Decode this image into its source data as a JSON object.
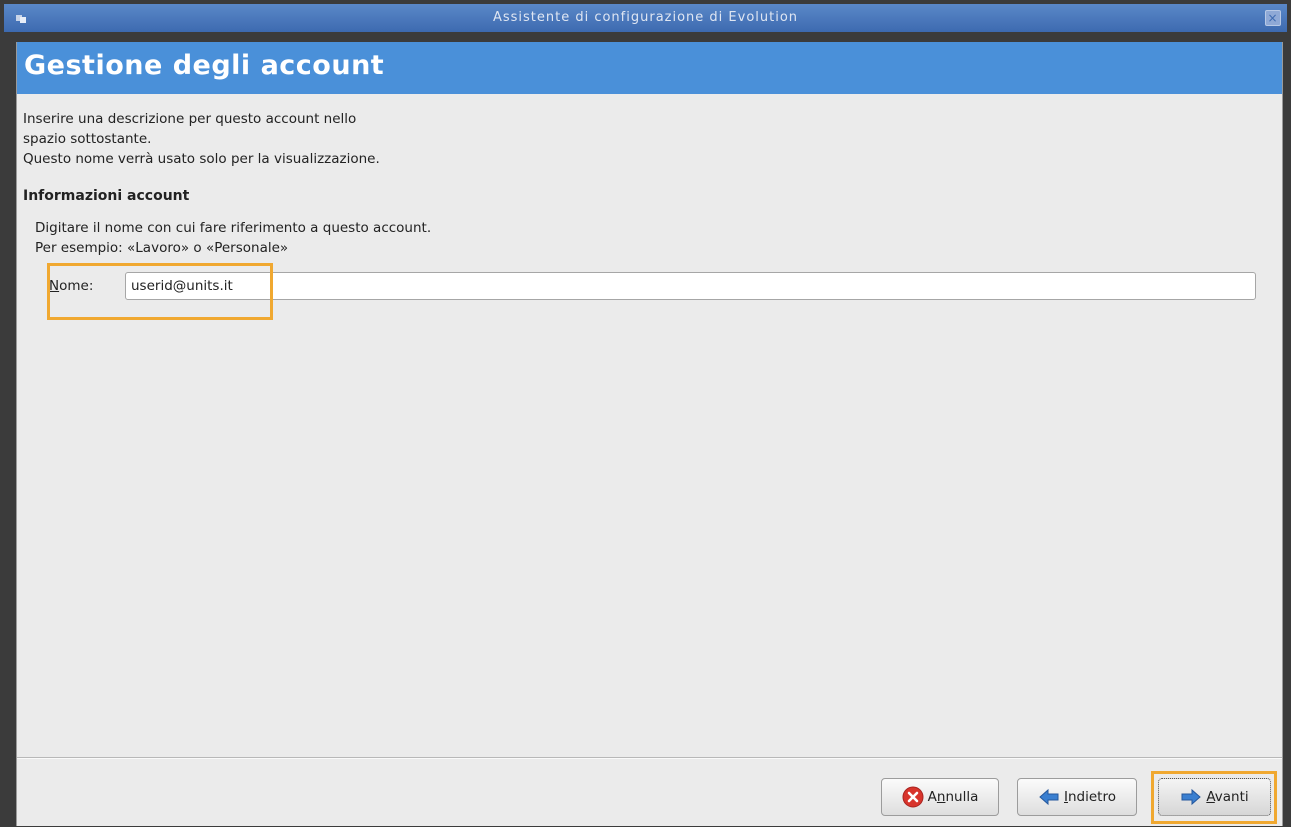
{
  "window": {
    "title": "Assistente di configurazione di Evolution"
  },
  "header": {
    "title": "Gestione degli account"
  },
  "intro": {
    "line1": "Inserire una descrizione per questo account nello",
    "line2": "spazio sottostante.",
    "line3": "Questo nome verrà usato solo per la visualizzazione."
  },
  "account_info": {
    "section_title": "Informazioni account",
    "hint_line1": "Digitare il nome con cui fare riferimento a questo account.",
    "hint_line2": "Per esempio: «Lavoro» o «Personale»",
    "name_label_mnemonic": "N",
    "name_label_rest": "ome:",
    "name_value": "userid@units.it"
  },
  "buttons": {
    "cancel": {
      "pre": "A",
      "mnemonic": "n",
      "post": "nulla",
      "icon": "cancel-icon"
    },
    "back": {
      "pre": "",
      "mnemonic": "I",
      "post": "ndietro",
      "icon": "arrow-left-icon"
    },
    "next": {
      "pre": "",
      "mnemonic": "A",
      "post": "vanti",
      "icon": "arrow-right-icon"
    }
  },
  "colors": {
    "titlebar": "#4a7abf",
    "header_banner": "#4a90d9",
    "highlight": "#f0a830",
    "cancel_icon": "#d8342c",
    "arrow_icon": "#3a7fd0"
  }
}
